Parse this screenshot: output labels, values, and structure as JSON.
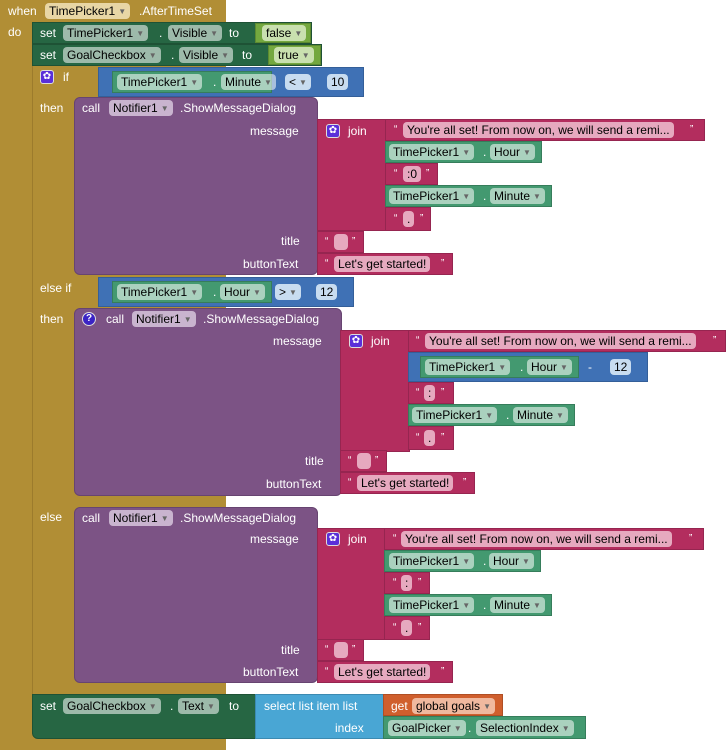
{
  "event": {
    "when_label": "when",
    "component": "TimePicker1",
    "event_name": ".AfterTimeSet",
    "do_label": "do"
  },
  "set1": {
    "set_label": "set",
    "component": "TimePicker1",
    "dot": ".",
    "property": "Visible",
    "to_label": "to",
    "value": "false"
  },
  "set2": {
    "set_label": "set",
    "component": "GoalCheckbox",
    "dot": ".",
    "property": "Visible",
    "to_label": "to",
    "value": "true"
  },
  "if_block": {
    "if_label": "if",
    "else_if_label": "else if",
    "then_label": "then",
    "else_label": "else",
    "cond1": {
      "component": "TimePicker1",
      "dot": ".",
      "property": "Minute",
      "operator": "<",
      "value": "10"
    },
    "cond2": {
      "component": "TimePicker1",
      "dot": ".",
      "property": "Hour",
      "operator": ">",
      "value": "12"
    }
  },
  "branches": [
    {
      "call_label": "call",
      "component": "Notifier1",
      "method": ".ShowMessageDialog",
      "message_label": "message",
      "title_label": "title",
      "button_label": "buttonText",
      "join_label": "join",
      "text1": "You're all set! From now on, we will send a remi...",
      "hour_component": "TimePicker1",
      "hour_property": "Hour",
      "sep": ":0",
      "minute_component": "TimePicker1",
      "minute_property": "Minute",
      "end": ".",
      "title_text": "",
      "button_text": "Let's get started!"
    },
    {
      "call_label": "call",
      "component": "Notifier1",
      "method": ".ShowMessageDialog",
      "message_label": "message",
      "title_label": "title",
      "button_label": "buttonText",
      "join_label": "join",
      "text1": "You're all set! From now on, we will send a remi...",
      "hour_component": "TimePicker1",
      "hour_property": "Hour",
      "minus_op": "-",
      "minus_value": "12",
      "sep": ":",
      "minute_component": "TimePicker1",
      "minute_property": "Minute",
      "end": ".",
      "title_text": "",
      "button_text": "Let's get started!"
    },
    {
      "call_label": "call",
      "component": "Notifier1",
      "method": ".ShowMessageDialog",
      "message_label": "message",
      "title_label": "title",
      "button_label": "buttonText",
      "join_label": "join",
      "text1": "You're all set! From now on, we will send a remi...",
      "hour_component": "TimePicker1",
      "hour_property": "Hour",
      "sep": ":",
      "minute_component": "TimePicker1",
      "minute_property": "Minute",
      "end": ".",
      "title_text": "",
      "button_text": "Let's get started!"
    }
  ],
  "set3": {
    "set_label": "set",
    "component": "GoalCheckbox",
    "dot": ".",
    "property": "Text",
    "to_label": "to",
    "select_label": "select list item  list",
    "get_label": "get",
    "variable": "global goals",
    "index_label": "index",
    "index_component": "GoalPicker",
    "index_property": "SelectionIndex"
  },
  "quote_open": "“",
  "quote_close": "”",
  "icons": {
    "mutator": "gear-icon",
    "help": "question-icon",
    "dropdown": "chevron-down-icon"
  }
}
